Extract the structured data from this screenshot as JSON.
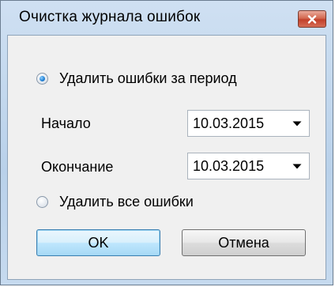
{
  "window": {
    "title": "Очистка журнала ошибок"
  },
  "options": {
    "delete_period_label": "Удалить ошибки за период",
    "delete_period_selected": true,
    "delete_all_label": "Удалить все ошибки",
    "delete_all_selected": false
  },
  "start": {
    "label": "Начало",
    "value": "10.03.2015"
  },
  "end": {
    "label": "Окончание",
    "value": "10.03.2015"
  },
  "buttons": {
    "ok_label": "OK",
    "cancel_label": "Отмена"
  },
  "colors": {
    "window_frame": "#b9d1ea",
    "client_bg": "#f0f0f0",
    "close_button": "#c2402a",
    "default_button_border": "#3c7fb1"
  },
  "icons": {
    "close": "close-icon",
    "dropdown": "chevron-down-icon"
  }
}
